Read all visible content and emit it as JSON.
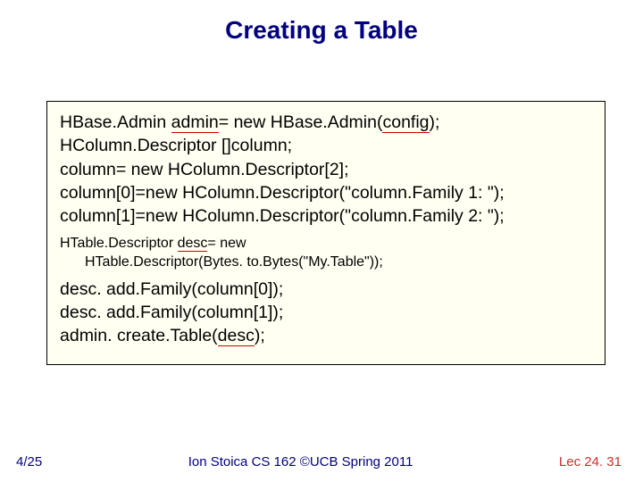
{
  "title": "Creating a Table",
  "code": {
    "l1a": "HBase.Admin ",
    "l1b": "admin",
    "l1c": "= new HBase.Admin(",
    "l1d": "config",
    "l1e": ");",
    "l2": "HColumn.Descriptor []column;",
    "l3": "column= new HColumn.Descriptor[2];",
    "l4": "column[0]=new HColumn.Descriptor(\"column.Family 1: \");",
    "l5": "column[1]=new HColumn.Descriptor(\"column.Family 2: \");",
    "l6a": "HTable.Descriptor ",
    "l6b": "desc",
    "l6c": "= new",
    "l7": "HTable.Descriptor(Bytes. to.Bytes(\"My.Table\"));",
    "l8": "desc. add.Family(column[0]);",
    "l9": "desc. add.Family(column[1]);",
    "l10a": "admin. create.Table(",
    "l10b": "desc",
    "l10c": ");"
  },
  "footer": {
    "left": "4/25",
    "center": "Ion Stoica CS 162 ©UCB Spring 2011",
    "right": "Lec 24. 31"
  }
}
